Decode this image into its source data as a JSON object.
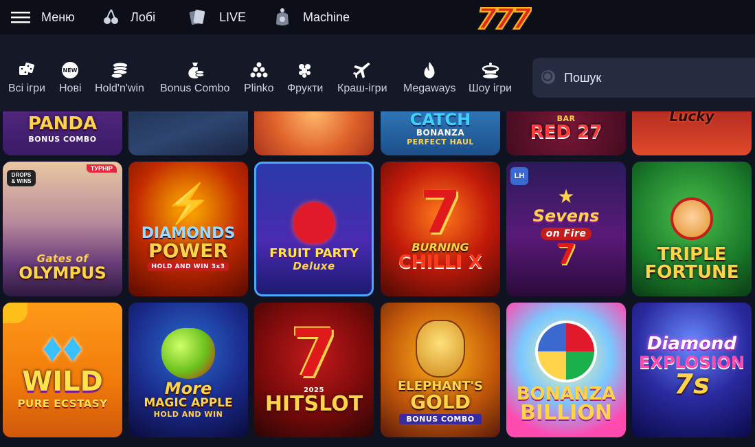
{
  "topbar": {
    "menu_label": "Меню",
    "lobby_label": "Лобі",
    "live_label": "LIVE",
    "machine_label": "Machine",
    "logo_text": "777"
  },
  "categories": [
    {
      "label": "Всі ігри",
      "icon": "dice-icon"
    },
    {
      "label": "Нові",
      "icon": "new-icon",
      "badge": "NEW"
    },
    {
      "label": "Hold'n'win",
      "icon": "coins-stack-icon"
    },
    {
      "label": "Bonus Combo",
      "icon": "money-bag-icon"
    },
    {
      "label": "Plinko",
      "icon": "plinko-icon"
    },
    {
      "label": "Фрукти",
      "icon": "grapes-icon"
    },
    {
      "label": "Краш-ігри",
      "icon": "plane-icon"
    },
    {
      "label": "Megaways",
      "icon": "flame-icon"
    },
    {
      "label": "Шоу ігри",
      "icon": "show-icon"
    }
  ],
  "search": {
    "placeholder": "Пошук"
  },
  "games_row1": [
    {
      "line1": "PANDA",
      "sub": "BONUS COMBO"
    },
    {
      "line1": ""
    },
    {
      "line1": ""
    },
    {
      "line1": "CATCH",
      "line2": "BONANZA",
      "sub": "PERFECT HAUL"
    },
    {
      "line1": "RED 27",
      "sub": "BAR"
    },
    {
      "line1": "Lucky"
    }
  ],
  "games_row2": [
    {
      "line1": "Gates of",
      "line2": "OLYMPUS",
      "badge": "ТУРНІР",
      "badge2": "DROPS & WINS"
    },
    {
      "line1": "DIAMONDS",
      "line2": "POWER",
      "sub": "HOLD AND WIN 3x3"
    },
    {
      "line1": "FRUIT PARTY",
      "line2": "Deluxe"
    },
    {
      "line1": "BURNING",
      "line2": "CHILLI X"
    },
    {
      "line1": "Sevens",
      "line2": "on Fire"
    },
    {
      "line1": "TRIPLE",
      "line2": "FORTUNE"
    }
  ],
  "games_row3": [
    {
      "line1": "WILD",
      "line2": "PURE ECSTASY"
    },
    {
      "line1": "More",
      "line2": "MAGIC APPLE",
      "sub": "HOLD AND WIN"
    },
    {
      "line1": "2025",
      "line2": "HITSLOT"
    },
    {
      "line1": "ELEPHANT'S",
      "line2": "GOLD",
      "sub": "BONUS COMBO"
    },
    {
      "line1": "BONANZA",
      "line2": "BILLION"
    },
    {
      "line1": "Diamond",
      "line2": "EXPLOSION",
      "sub": "7s"
    }
  ],
  "colors": {
    "topbar_bg": "#0c0e18",
    "catbar_bg": "#141827",
    "search_bg": "#262c40",
    "logo_red": "#e3261b",
    "logo_gold": "#f5b21e"
  }
}
